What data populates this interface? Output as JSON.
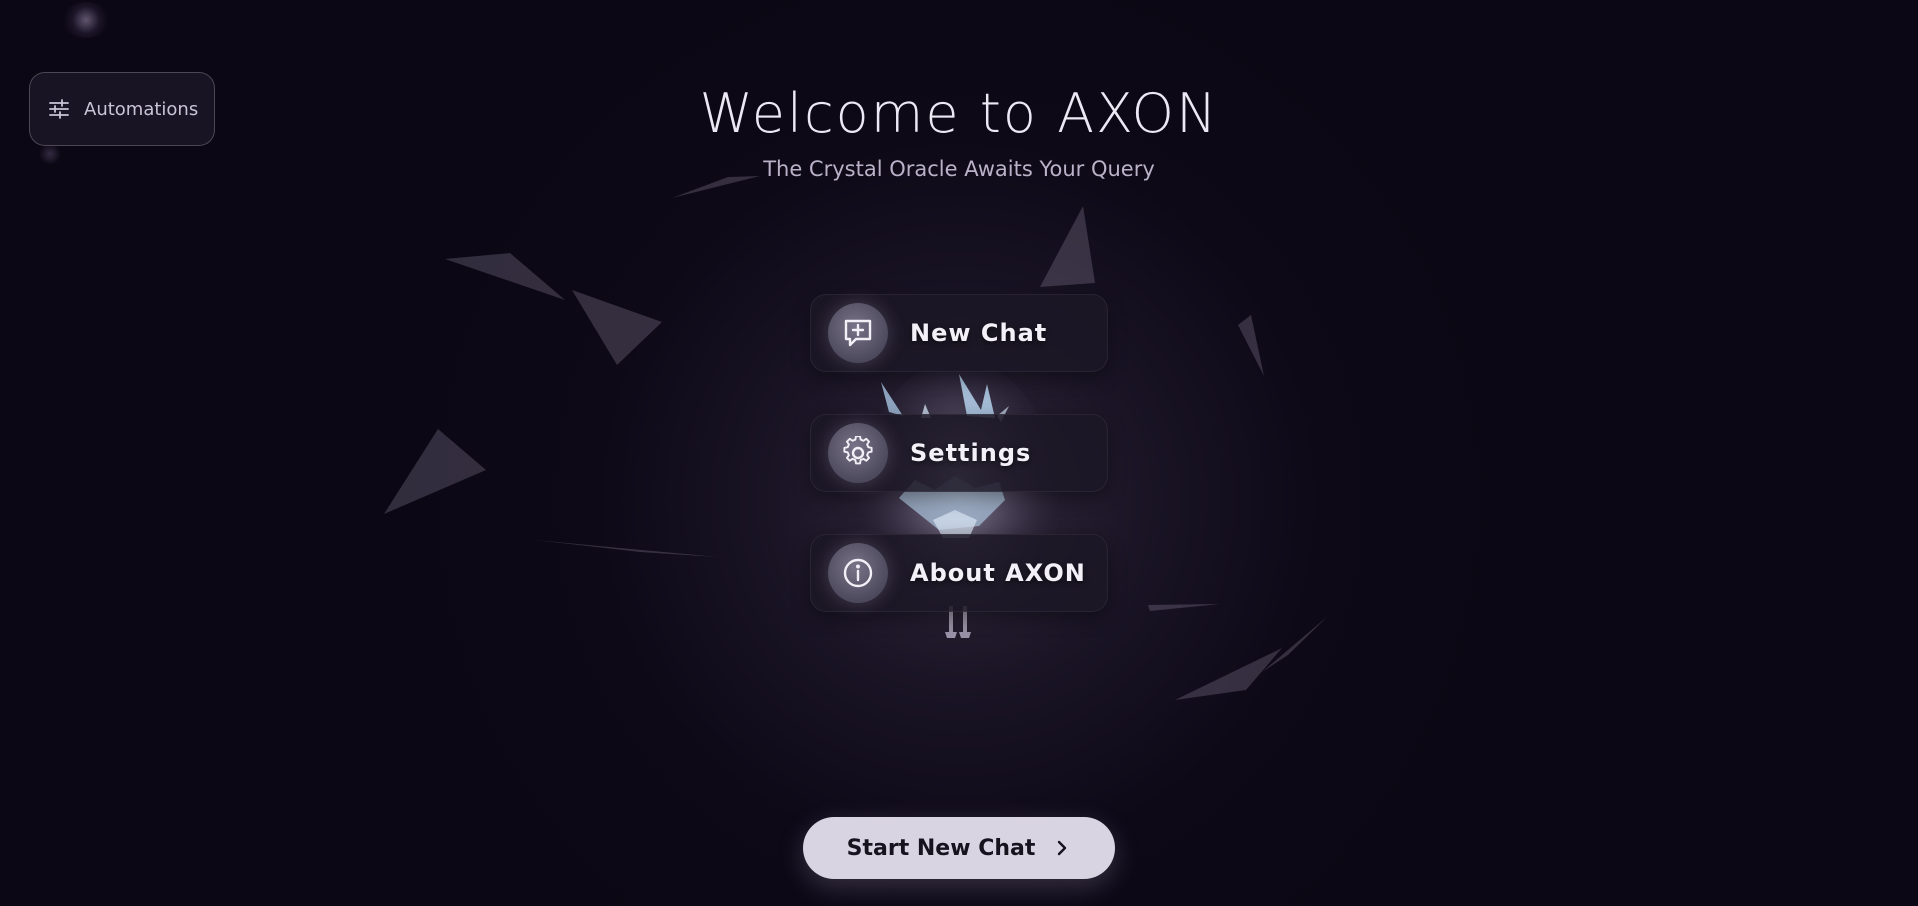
{
  "app": {
    "title": "Welcome to AXON",
    "subtitle": "The Crystal Oracle Awaits Your Query"
  },
  "toolbar": {
    "automations_label": "Automations",
    "automations_icon": "sliders-icon"
  },
  "menu": {
    "items": [
      {
        "label": "New Chat",
        "icon": "chat-plus-icon"
      },
      {
        "label": "Settings",
        "icon": "gear-icon"
      },
      {
        "label": "About AXON",
        "icon": "info-icon"
      }
    ]
  },
  "cta": {
    "label": "Start New Chat",
    "icon": "chevron-right-icon"
  },
  "theme": {
    "background": "#0b0714",
    "card": "#1c1725",
    "text": "#f3f0f8",
    "cta_background": "#d8d4e2",
    "cta_text": "#16121e"
  }
}
